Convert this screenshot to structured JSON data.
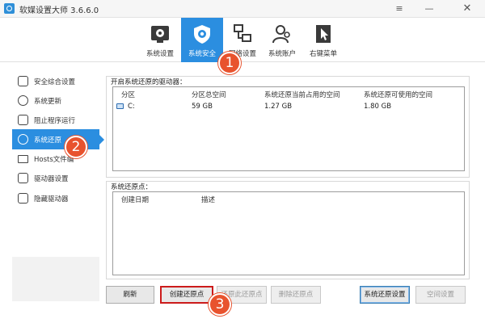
{
  "window": {
    "title": "软媒设置大师 3.6.6.0",
    "controls": {
      "menu": "≡",
      "minimize": "—",
      "close": "✕"
    }
  },
  "toolbar": {
    "items": [
      {
        "label": "系统设置",
        "icon": "system-settings-icon"
      },
      {
        "label": "系统安全",
        "icon": "shield-gear-icon",
        "active": true
      },
      {
        "label": "网络设置",
        "icon": "network-icon"
      },
      {
        "label": "系统账户",
        "icon": "users-icon"
      },
      {
        "label": "右键菜单",
        "icon": "cursor-menu-icon"
      }
    ]
  },
  "sidebar": {
    "items": [
      {
        "label": "安全综合设置",
        "icon": "shield-settings-icon"
      },
      {
        "label": "系统更新",
        "icon": "refresh-icon"
      },
      {
        "label": "阻止程序运行",
        "icon": "block-window-icon"
      },
      {
        "label": "系统还原",
        "icon": "restore-icon",
        "active": true
      },
      {
        "label": "Hosts文件编",
        "icon": "hosts-file-icon"
      },
      {
        "label": "驱动器设置",
        "icon": "drive-settings-icon"
      },
      {
        "label": "隐藏驱动器",
        "icon": "hidden-drive-icon"
      }
    ]
  },
  "drives_panel": {
    "label": "开启系统还原的驱动器：",
    "columns": [
      "分区",
      "分区总空间",
      "系统还原当前占用的空间",
      "系统还原可使用的空间"
    ],
    "rows": [
      {
        "partition": "C:",
        "total": "59 GB",
        "used": "1.27 GB",
        "available": "1.80 GB"
      }
    ]
  },
  "restore_points_panel": {
    "label": "系统还原点：",
    "columns": [
      "创建日期",
      "描述"
    ],
    "rows": []
  },
  "buttons": {
    "refresh": "刷新",
    "create": "创建还原点",
    "restore": "还原此还原点",
    "delete": "删除还原点",
    "settings": "系统还原设置",
    "space": "空间设置"
  },
  "badges": [
    "1",
    "2",
    "3"
  ],
  "colors": {
    "accent": "#2b8ee0",
    "badge": "#e8532e",
    "highlight_border": "#cc1b1b"
  }
}
